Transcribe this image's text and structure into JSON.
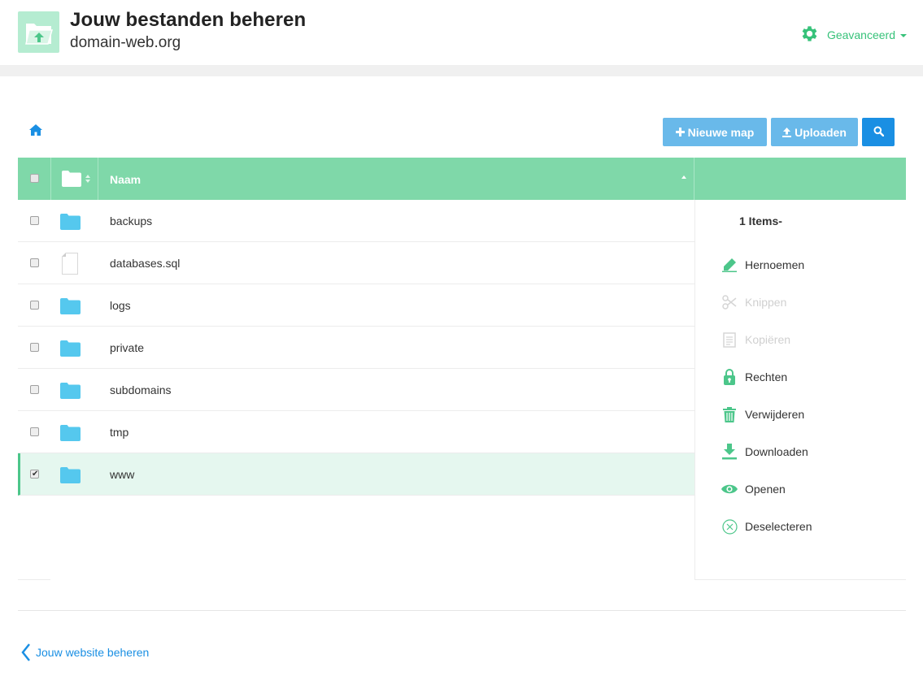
{
  "header": {
    "title": "Jouw bestanden beheren",
    "subtitle": "domain-web.org",
    "advanced_label": "Geavanceerd"
  },
  "toolbar": {
    "new_folder_label": "Nieuwe map",
    "upload_label": "Uploaden"
  },
  "table": {
    "name_header": "Naam",
    "rows": [
      {
        "name": "backups",
        "type": "folder",
        "checked": false
      },
      {
        "name": "databases.sql",
        "type": "file",
        "checked": false
      },
      {
        "name": "logs",
        "type": "folder",
        "checked": false
      },
      {
        "name": "private",
        "type": "folder",
        "checked": false
      },
      {
        "name": "subdomains",
        "type": "folder",
        "checked": false
      },
      {
        "name": "tmp",
        "type": "folder",
        "checked": false
      },
      {
        "name": "www",
        "type": "folder",
        "checked": true
      }
    ]
  },
  "panel": {
    "items_count": "1 Items-",
    "actions": [
      {
        "label": "Hernoemen",
        "icon": "pencil-icon",
        "enabled": true
      },
      {
        "label": "Knippen",
        "icon": "scissors-icon",
        "enabled": false
      },
      {
        "label": "Kopiëren",
        "icon": "copy-icon",
        "enabled": false
      },
      {
        "label": "Rechten",
        "icon": "lock-icon",
        "enabled": true
      },
      {
        "label": "Verwijderen",
        "icon": "trash-icon",
        "enabled": true
      },
      {
        "label": "Downloaden",
        "icon": "download-icon",
        "enabled": true
      },
      {
        "label": "Openen",
        "icon": "eye-icon",
        "enabled": true
      },
      {
        "label": "Deselecteren",
        "icon": "close-circle-icon",
        "enabled": true
      }
    ]
  },
  "footer": {
    "back_label": "Jouw website beheren"
  },
  "colors": {
    "accent_green": "#37c27a",
    "header_green": "#7fd8a9",
    "blue": "#1a8fe3",
    "light_blue": "#69b9ea",
    "folder": "#55c8ee"
  }
}
